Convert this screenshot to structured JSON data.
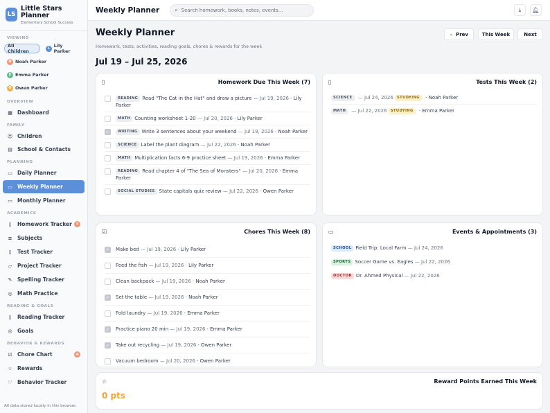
{
  "brand": {
    "initials": "LS",
    "name": "Little Stars Planner",
    "subtitle": "Elementary School Success"
  },
  "viewing": {
    "label": "VIEWING",
    "chips": [
      {
        "label": "All Children",
        "initial": "",
        "color": "#5b8fd9",
        "active": true
      },
      {
        "label": "Lily Parker",
        "initial": "L",
        "color": "#5b8fd9",
        "active": false
      },
      {
        "label": "Noah Parker",
        "initial": "N",
        "color": "#f29579",
        "active": false
      },
      {
        "label": "Emma Parker",
        "initial": "E",
        "color": "#5fbf8f",
        "active": false
      },
      {
        "label": "Owen Parker",
        "initial": "O",
        "color": "#f0b04a",
        "active": false
      }
    ]
  },
  "sidebar": {
    "overview_label": "OVERVIEW",
    "dashboard": "Dashboard",
    "family_label": "FAMILY",
    "children": "Children",
    "school_contacts": "School & Contacts",
    "planning_label": "PLANNING",
    "daily_planner": "Daily Planner",
    "weekly_planner": "Weekly Planner",
    "monthly_planner": "Monthly Planner",
    "academics_label": "ACADEMICS",
    "homework_tracker": "Homework Tracker",
    "homework_badge": "7",
    "subjects": "Subjects",
    "test_tracker": "Test Tracker",
    "project_tracker": "Project Tracker",
    "spelling_tracker": "Spelling Tracker",
    "math_practice": "Math Practice",
    "reading_goals_label": "READING & GOALS",
    "reading_tracker": "Reading Tracker",
    "goals": "Goals",
    "behavior_label": "BEHAVIOR & REWARDS",
    "chore_chart": "Chore Chart",
    "chore_badge": "4",
    "rewards": "Rewards",
    "behavior_tracker": "Behavior Tracker",
    "footer": "All data stored locally in this browser."
  },
  "topbar": {
    "title": "Weekly Planner",
    "search_placeholder": "Search homework, books, notes, events..."
  },
  "page": {
    "title": "Weekly Planner",
    "subtitle": "Homework, tests, activities, reading goals, chores & rewards for the week",
    "date_range": "Jul 19 – Jul 25, 2026",
    "prev": "Prev",
    "this_week": "This Week",
    "next": "Next"
  },
  "homework": {
    "title": "Homework Due This Week (7)",
    "items": [
      {
        "subject": "READING",
        "text": "Read \"The Cat in the Hat\" and draw a picture",
        "date": " — Jul 19, 2026",
        "child": " · Lily Parker",
        "done": false
      },
      {
        "subject": "MATH",
        "text": "Counting worksheet 1-20",
        "date": " — Jul 20, 2026",
        "child": " · Lily Parker",
        "done": false
      },
      {
        "subject": "WRITING",
        "text": "Write 3 sentences about your weekend",
        "date": " — Jul 19, 2026",
        "child": " · Noah Parker",
        "done": true
      },
      {
        "subject": "SCIENCE",
        "text": "Label the plant diagram",
        "date": " — Jul 22, 2026",
        "child": " · Noah Parker",
        "done": false
      },
      {
        "subject": "MATH",
        "text": "Multiplication facts 6-9 practice sheet",
        "date": " — Jul 19, 2026",
        "child": " · Emma Parker",
        "done": false
      },
      {
        "subject": "READING",
        "text": "Read chapter 4 of \"The Sea of Monsters\"",
        "date": " — Jul 20, 2026",
        "child": " · Emma Parker",
        "done": false
      },
      {
        "subject": "SOCIAL STUDIES",
        "text": "State capitals quiz review",
        "date": " — Jul 22, 2026",
        "child": " · Owen Parker",
        "done": false
      }
    ]
  },
  "tests": {
    "title": "Tests This Week (2)",
    "items": [
      {
        "subject": "SCIENCE",
        "date": " — Jul 24, 2026 ",
        "status": "STUDYING",
        "child": " · Noah Parker"
      },
      {
        "subject": "MATH",
        "date": " — Jul 22, 2026 ",
        "status": "STUDYING",
        "child": " · Emma Parker"
      }
    ]
  },
  "chores": {
    "title": "Chores This Week (8)",
    "items": [
      {
        "text": "Make bed",
        "date": " — Jul 19, 2026",
        "child": " · Lily Parker",
        "done": true
      },
      {
        "text": "Feed the fish",
        "date": " — Jul 19, 2026",
        "child": " · Lily Parker",
        "done": false
      },
      {
        "text": "Clean backpack",
        "date": " — Jul 19, 2026",
        "child": " · Noah Parker",
        "done": false
      },
      {
        "text": "Set the table",
        "date": " — Jul 19, 2026",
        "child": " · Noah Parker",
        "done": true
      },
      {
        "text": "Fold laundry",
        "date": " — Jul 19, 2026",
        "child": " · Emma Parker",
        "done": false
      },
      {
        "text": "Practice piano 20 min",
        "date": " — Jul 19, 2026",
        "child": " · Emma Parker",
        "done": true
      },
      {
        "text": "Take out recycling",
        "date": " — Jul 19, 2026",
        "child": " · Owen Parker",
        "done": true
      },
      {
        "text": "Vacuum bedroom",
        "date": " — Jul 20, 2026",
        "child": " · Owen Parker",
        "done": false
      }
    ]
  },
  "events": {
    "title": "Events & Appointments (3)",
    "items": [
      {
        "type": "SCHOOL",
        "style": "blue",
        "text": "Field Trip: Local Farm",
        "date": " — Jul 24, 2026"
      },
      {
        "type": "SPORTS",
        "style": "green",
        "text": "Soccer Game vs. Eagles",
        "date": " — Jul 22, 2026"
      },
      {
        "type": "DOCTOR",
        "style": "red",
        "text": "Dr. Ahmed Physical",
        "date": " — Jul 22, 2026"
      }
    ]
  },
  "rewards": {
    "title": "Reward Points Earned This Week",
    "points": "0 pts"
  },
  "icons": {
    "search": "search-icon",
    "download": "download-icon",
    "bell": "bell-icon"
  }
}
